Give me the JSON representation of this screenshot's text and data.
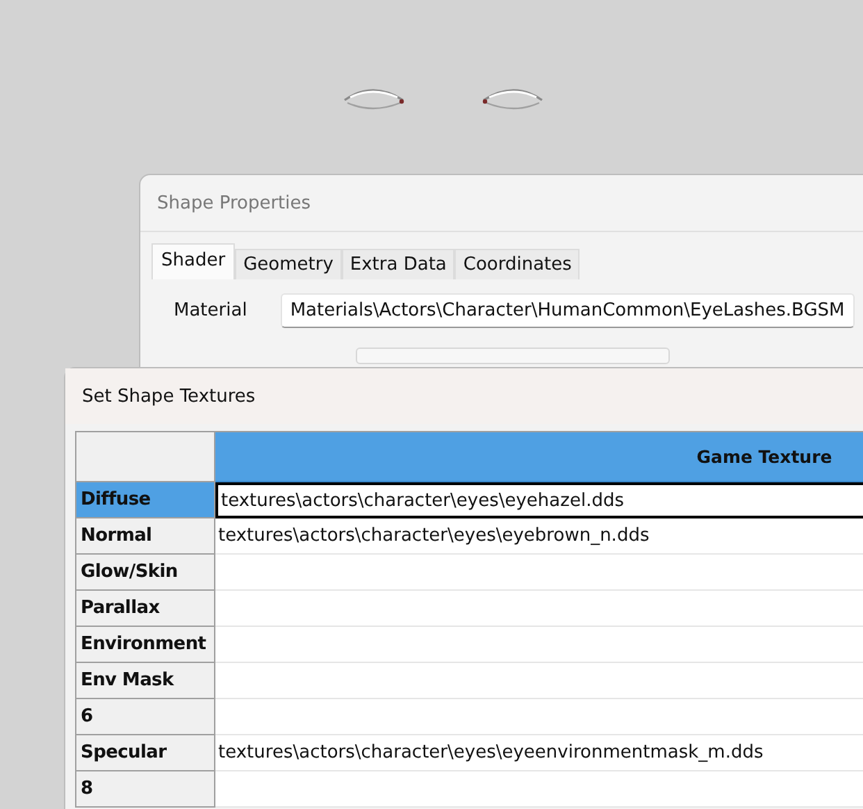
{
  "shape_properties": {
    "title": "Shape Properties",
    "tabs": [
      {
        "label": "Shader",
        "selected": true
      },
      {
        "label": "Geometry",
        "selected": false
      },
      {
        "label": "Extra Data",
        "selected": false
      },
      {
        "label": "Coordinates",
        "selected": false
      }
    ],
    "material": {
      "label": "Material",
      "value": "Materials\\Actors\\Character\\HumanCommon\\EyeLashes.BGSM"
    }
  },
  "set_shape_textures": {
    "title": "Set Shape Textures",
    "table": {
      "columns": [
        "Game Texture"
      ],
      "rows": [
        {
          "label": "Diffuse",
          "value": "textures\\actors\\character\\eyes\\eyehazel.dds",
          "selected": true
        },
        {
          "label": "Normal",
          "value": "textures\\actors\\character\\eyes\\eyebrown_n.dds",
          "selected": false
        },
        {
          "label": "Glow/Skin",
          "value": "",
          "selected": false
        },
        {
          "label": "Parallax",
          "value": "",
          "selected": false
        },
        {
          "label": "Environment",
          "value": "",
          "selected": false
        },
        {
          "label": "Env Mask",
          "value": "",
          "selected": false
        },
        {
          "label": "6",
          "value": "",
          "selected": false
        },
        {
          "label": "Specular",
          "value": "textures\\actors\\character\\eyes\\eyeenvironmentmask_m.dds",
          "selected": false
        },
        {
          "label": "8",
          "value": "",
          "selected": false
        }
      ]
    }
  }
}
